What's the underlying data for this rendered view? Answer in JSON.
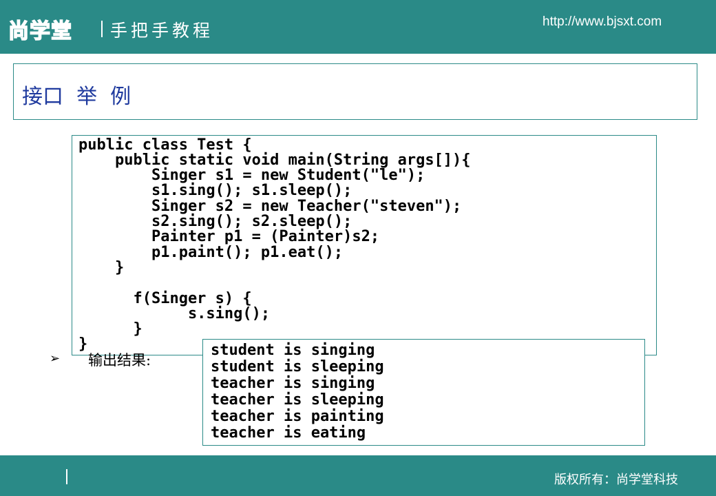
{
  "header": {
    "logo": "尚学堂",
    "subtitle": "手把手教程",
    "url": "http://www.bjsxt.com"
  },
  "slide": {
    "title": "接口  举  例"
  },
  "code": {
    "lines": [
      "public class Test {",
      "    public static void main(String args[]){",
      "        Singer s1 = new Student(\"le\");",
      "        s1.sing(); s1.sleep();",
      "        Singer s2 = new Teacher(\"steven\");",
      "        s2.sing(); s2.sleep();",
      "        Painter p1 = (Painter)s2;",
      "        p1.paint(); p1.eat();",
      "    }",
      "",
      "      f(Singer s) {",
      "            s.sing();",
      "      }",
      "}"
    ]
  },
  "output": {
    "bullet": "➢",
    "label": "输出结果:",
    "lines": [
      "student is singing",
      "student is sleeping",
      "teacher is singing",
      "teacher is sleeping",
      "teacher is painting",
      "teacher is eating"
    ]
  },
  "footer": {
    "copyright": "版权所有：尚学堂科技"
  },
  "colors": {
    "brand_teal": "#2a8a87",
    "title_blue": "#1f3a9e"
  }
}
